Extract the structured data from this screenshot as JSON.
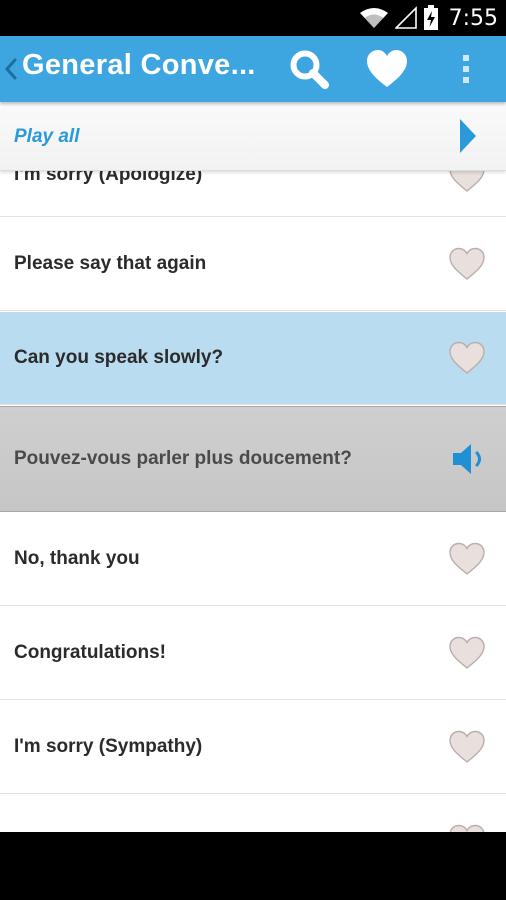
{
  "status_bar": {
    "time": "7:55",
    "icons": [
      "wifi-icon",
      "signal-icon",
      "battery-charging-icon"
    ]
  },
  "action_bar": {
    "back_icon": "chevron-left-icon",
    "title": "General Conve...",
    "actions": [
      "search-icon",
      "heart-icon",
      "overflow-menu-icon"
    ],
    "color": "#3da5e0"
  },
  "play_bar": {
    "label": "Play all",
    "icon": "play-icon",
    "accent": "#2a9ad8"
  },
  "phrases": [
    {
      "text": "I'm sorry (Apologize)",
      "icon": "heart-icon",
      "state": "normal"
    },
    {
      "text": "Please say that again",
      "icon": "heart-icon",
      "state": "normal"
    },
    {
      "text": "Can you speak slowly?",
      "icon": "heart-icon",
      "state": "selected"
    },
    {
      "text": "Pouvez-vous parler plus doucement?",
      "icon": "speaker-icon",
      "state": "translation"
    },
    {
      "text": "No, thank you",
      "icon": "heart-icon",
      "state": "normal"
    },
    {
      "text": "Congratulations!",
      "icon": "heart-icon",
      "state": "normal"
    },
    {
      "text": "I'm sorry (Sympathy)",
      "icon": "heart-icon",
      "state": "normal"
    },
    {
      "text": "",
      "icon": "heart-icon",
      "state": "normal"
    }
  ],
  "colors": {
    "selected_row": "#b9dcf0",
    "translation_row": "#c9c9c9",
    "speaker": "#1f8fd6"
  }
}
